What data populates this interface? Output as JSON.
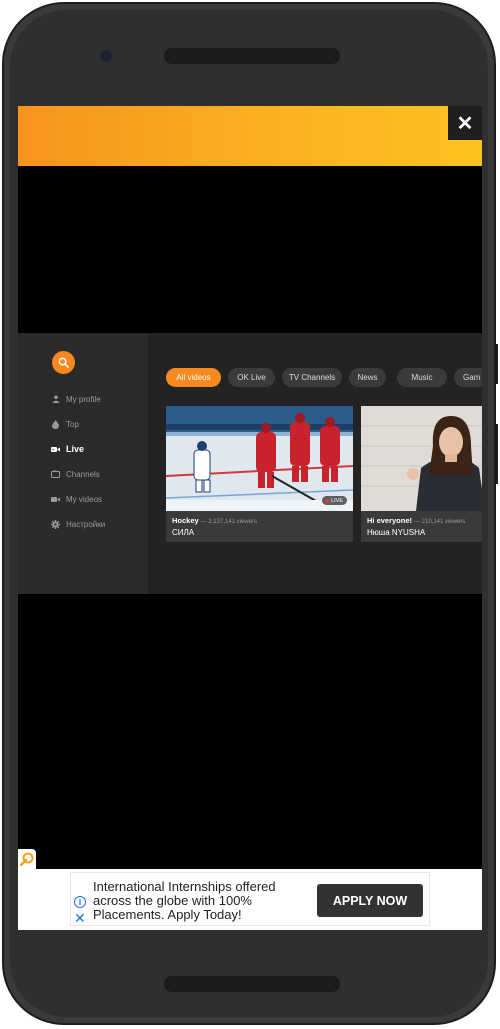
{
  "banner": {
    "close_icon": "close-icon",
    "close_glyph": "✕"
  },
  "sidebar": {
    "search_icon": "search-icon",
    "items": [
      {
        "label": "My profile",
        "icon": "person-icon",
        "active": false
      },
      {
        "label": "Top",
        "icon": "flame-icon",
        "active": false
      },
      {
        "label": "Live",
        "icon": "live-camera-icon",
        "active": true
      },
      {
        "label": "Channels",
        "icon": "tv-icon",
        "active": false
      },
      {
        "label": "My videos",
        "icon": "video-camera-icon",
        "active": false
      },
      {
        "label": "Настройки",
        "icon": "gear-icon",
        "active": false
      }
    ]
  },
  "tabs": [
    {
      "label": "All videos",
      "active": true
    },
    {
      "label": "OK Live",
      "active": false
    },
    {
      "label": "TV Channels",
      "active": false
    },
    {
      "label": "News",
      "active": false
    },
    {
      "label": "Music",
      "active": false
    },
    {
      "label": "Gam",
      "active": false
    }
  ],
  "videos": [
    {
      "title": "Hockey",
      "viewers": "— 2,137,141 viewers",
      "author": "СИЛА",
      "badge": "LIVE"
    },
    {
      "title": "Hi everyone!",
      "viewers": "— 210,141 viewers",
      "author": "Нюша NYUSHA",
      "badge": ""
    }
  ],
  "ad": {
    "text": "International Internships offered across the globe with 100% Placements. Apply Today!",
    "cta": "APPLY NOW",
    "info_glyph": "i",
    "close_glyph": "✕"
  },
  "colors": {
    "accent": "#f7891f",
    "banner_start": "#f7931e",
    "banner_end": "#fdc21f",
    "background": "#232323"
  }
}
